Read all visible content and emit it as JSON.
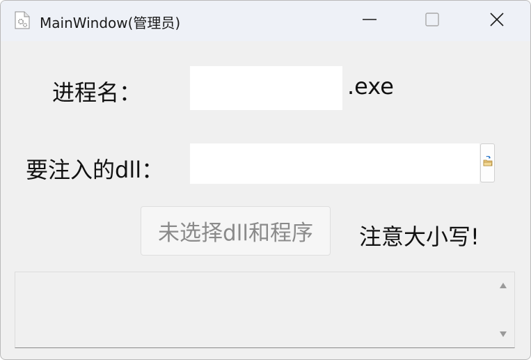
{
  "window": {
    "title": "MainWindow(管理员)"
  },
  "form": {
    "process_label": "进程名：",
    "process_value": "",
    "exe_suffix": ".exe",
    "dll_label": "要注入的dll：",
    "dll_value": "",
    "action_button_label": "未选择dll和程序",
    "note_text": "注意大小写!"
  },
  "log": {
    "text": ""
  },
  "icons": {
    "app": "settings-document-icon",
    "browse": "open-folder-icon",
    "minimize": "minimize-icon",
    "maximize": "maximize-icon",
    "close": "close-icon",
    "scroll_up": "triangle-up-icon",
    "scroll_down": "triangle-down-icon"
  },
  "colors": {
    "titlebar": "#eef1f7",
    "window_bg": "#f0f0f0",
    "disabled_text": "#8a8a8a"
  }
}
